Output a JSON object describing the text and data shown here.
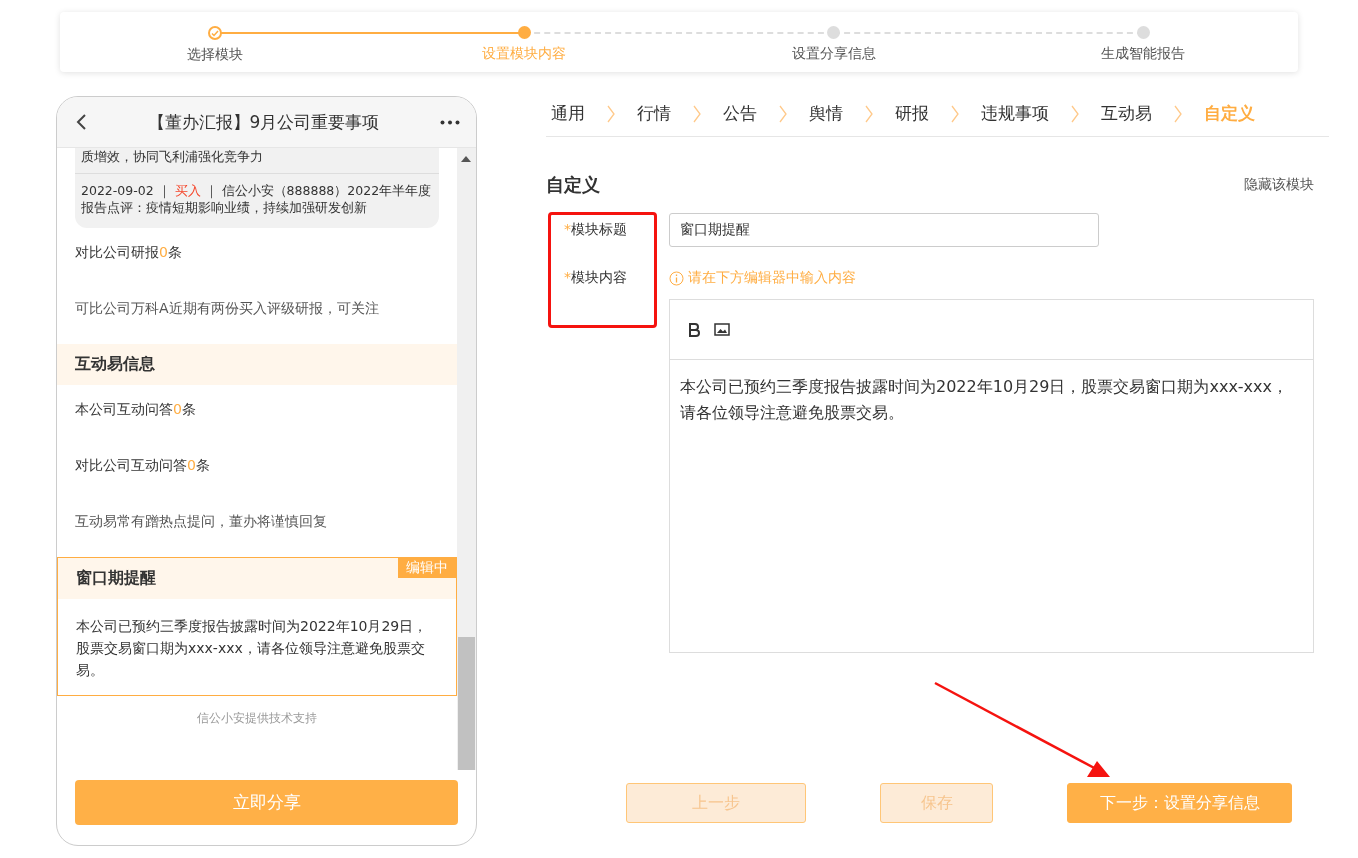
{
  "steps": [
    {
      "label": "选择模块",
      "completed": true,
      "selected": false
    },
    {
      "label": "设置模块内容",
      "completed": false,
      "selected": true
    },
    {
      "label": "设置分享信息",
      "completed": false,
      "selected": false
    },
    {
      "label": "生成智能报告",
      "completed": false,
      "selected": false
    }
  ],
  "phone": {
    "title": "【董办汇报】9月公司重要事项",
    "reports": [
      {
        "text": "质增效，协同飞利浦强化竞争力"
      },
      {
        "date": "2022-09-02",
        "separator": "｜",
        "rating": "买入",
        "text": "信公小安（888888）2022年半年度报告点评：疫情短期影响业绩，持续加强研发创新"
      }
    ],
    "items": [
      {
        "kind": "count",
        "prefix": "对比公司研报",
        "count": "0",
        "suffix": "条"
      },
      {
        "kind": "note",
        "text": "可比公司万科A近期有两份买入评级研报，可关注"
      },
      {
        "kind": "heading",
        "text": "互动易信息"
      },
      {
        "kind": "count",
        "prefix": "本公司互动问答",
        "count": "0",
        "suffix": "条"
      },
      {
        "kind": "count",
        "prefix": "对比公司互动问答",
        "count": "0",
        "suffix": "条"
      },
      {
        "kind": "note",
        "text": "互动易常有蹭热点提问，董办将谨慎回复"
      },
      {
        "kind": "module",
        "title": "窗口期提醒",
        "badge": "编辑中",
        "editing": true,
        "body": "本公司已预约三季度报告披露时间为2022年10月29日，股票交易窗口期为xxx-xxx，请各位领导注意避免股票交易。"
      }
    ],
    "footer": "信公小安提供技术支持",
    "share_button": "立即分享"
  },
  "tabs": [
    {
      "label": "通用",
      "selected": false
    },
    {
      "label": "行情",
      "selected": false
    },
    {
      "label": "公告",
      "selected": false
    },
    {
      "label": "舆情",
      "selected": false
    },
    {
      "label": "研报",
      "selected": false
    },
    {
      "label": "违规事项",
      "selected": false
    },
    {
      "label": "互动易",
      "selected": false
    },
    {
      "label": "自定义",
      "selected": true
    }
  ],
  "form": {
    "title": "自定义",
    "hide_link": "隐藏该模块",
    "fields": [
      {
        "label": "模块标题",
        "required_mark": "*",
        "value": "窗口期提醒"
      },
      {
        "label": "模块内容",
        "required_mark": "*",
        "hint": "请在下方编辑器中输入内容"
      }
    ],
    "editor_text": "本公司已预约三季度报告披露时间为2022年10月29日，股票交易窗口期为xxx-xxx，请各位领导注意避免股票交易。"
  },
  "buttons": [
    {
      "label": "上一步",
      "disabled": true
    },
    {
      "label": "保存",
      "disabled": true
    },
    {
      "label": "下一步：设置分享信息",
      "disabled": false
    }
  ]
}
